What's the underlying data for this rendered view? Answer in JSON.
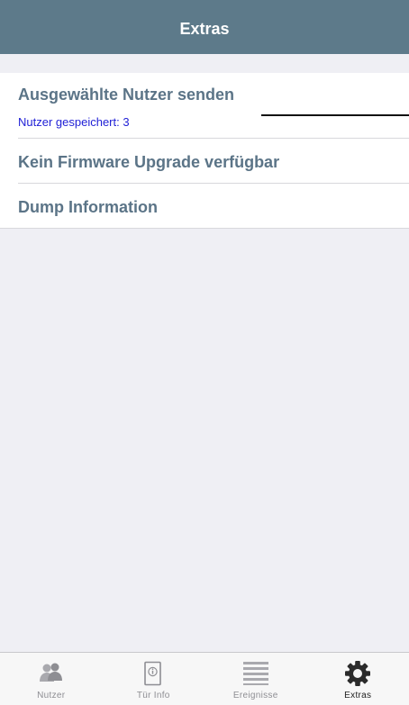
{
  "navbar": {
    "title": "Extras"
  },
  "menu": {
    "items": [
      {
        "label": "Ausgewählte Nutzer senden",
        "sublabel": "Nutzer gespeichert: 3"
      },
      {
        "label": "Kein Firmware Upgrade verfügbar"
      },
      {
        "label": "Dump Information"
      }
    ]
  },
  "tabbar": {
    "tabs": [
      {
        "label": "Nutzer",
        "icon": "users-icon",
        "active": false
      },
      {
        "label": "Tür Info",
        "icon": "door-info-icon",
        "active": false
      },
      {
        "label": "Ereignisse",
        "icon": "events-list-icon",
        "active": false
      },
      {
        "label": "Extras",
        "icon": "gear-icon",
        "active": true
      }
    ]
  },
  "colors": {
    "navbar": "#5d7a8a",
    "item_text": "#5b7487",
    "sublabel_text": "#1f1fd6",
    "background": "#efeff4",
    "tab_inactive": "#8e8e93",
    "tab_active": "#222222"
  }
}
